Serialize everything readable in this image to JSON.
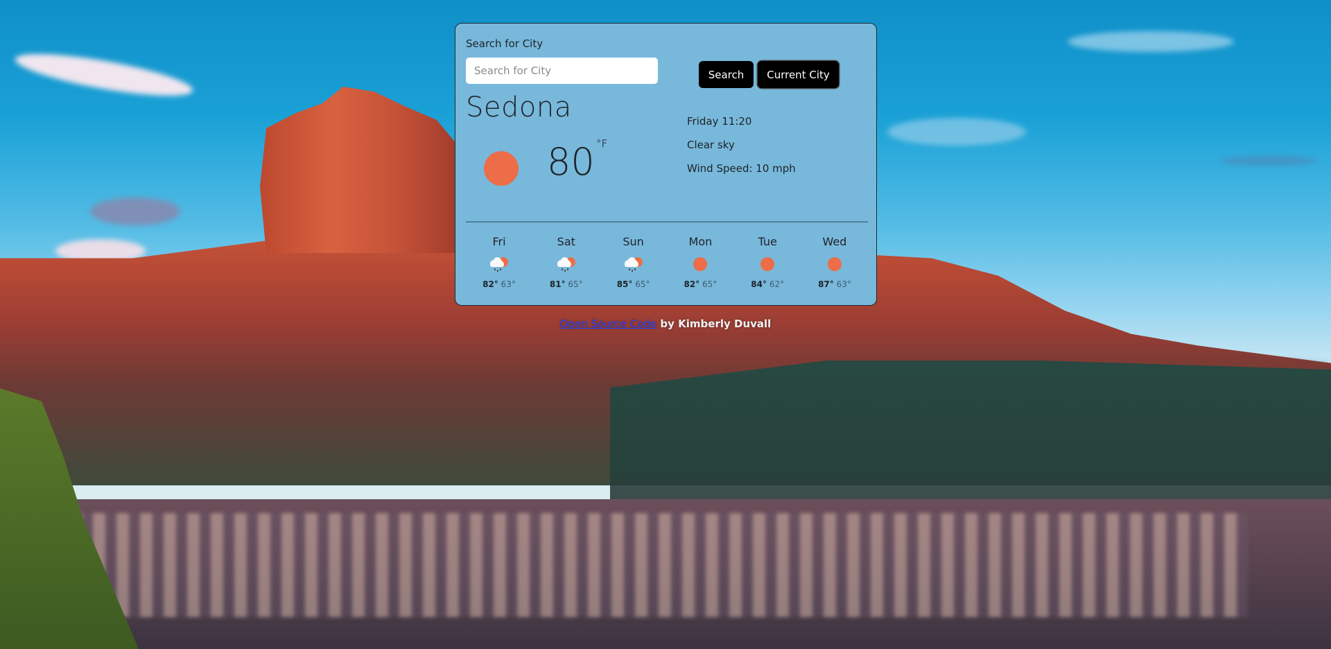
{
  "search": {
    "label": "Search for City",
    "placeholder": "Search for City",
    "value": "",
    "search_button": "Search",
    "current_city_button": "Current City"
  },
  "current": {
    "city": "Sedona",
    "temperature": "80",
    "unit": "°F",
    "icon": "sun-icon",
    "datetime": "Friday 11:20",
    "description": "Clear sky",
    "wind": "Wind Speed: 10 mph"
  },
  "forecast": [
    {
      "day": "Fri",
      "icon": "rain-sun-icon",
      "high": "82°",
      "low": "63°"
    },
    {
      "day": "Sat",
      "icon": "rain-sun-icon",
      "high": "81°",
      "low": "65°"
    },
    {
      "day": "Sun",
      "icon": "rain-sun-icon",
      "high": "85°",
      "low": "65°"
    },
    {
      "day": "Mon",
      "icon": "sun-icon",
      "high": "82°",
      "low": "65°"
    },
    {
      "day": "Tue",
      "icon": "sun-icon",
      "high": "84°",
      "low": "62°"
    },
    {
      "day": "Wed",
      "icon": "sun-icon",
      "high": "87°",
      "low": "63°"
    }
  ],
  "footer": {
    "link_text": "Open Source Code",
    "suffix": " by Kimberly Duvall"
  },
  "colors": {
    "card_background": "#78b8db",
    "sun": "#ec6d48",
    "button": "#000000",
    "link": "#2244ff"
  }
}
